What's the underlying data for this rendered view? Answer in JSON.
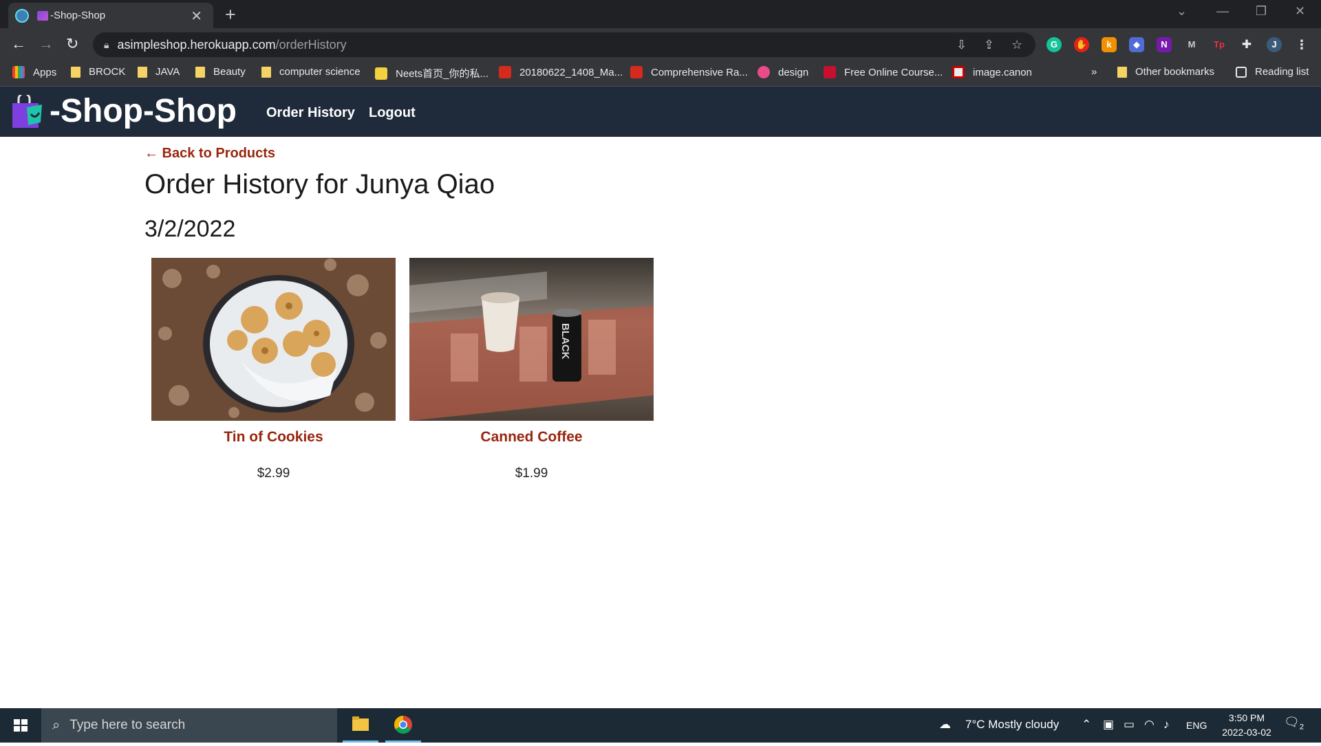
{
  "browser": {
    "tab_title": "-Shop-Shop",
    "url_host": "asimpleshop.herokuapp.com",
    "url_path": "/orderHistory",
    "bookmarks": [
      "Apps",
      "BROCK",
      "JAVA",
      "Beauty",
      "computer science",
      "Neets首页_你的私...",
      "20180622_1408_Ma...",
      "Comprehensive Ra...",
      "design",
      "Free Online Course...",
      "image.canon"
    ],
    "overflow": "»",
    "other_bookmarks": "Other bookmarks",
    "reading_list": "Reading list",
    "profile_initial": "J"
  },
  "site": {
    "title": "-Shop-Shop",
    "nav": [
      "Order History",
      "Logout"
    ]
  },
  "page": {
    "back_link": "← Back to Products",
    "title": "Order History for Junya Qiao",
    "order_date": "3/2/2022",
    "products": [
      {
        "name": "Tin of Cookies",
        "price": "$2.99",
        "image": "cookie-tin-photo"
      },
      {
        "name": "Canned Coffee",
        "price": "$1.99",
        "image": "coffee-can-photo"
      }
    ]
  },
  "taskbar": {
    "search_placeholder": "Type here to search",
    "weather": "7°C  Mostly cloudy",
    "language": "ENG",
    "time": "3:50 PM",
    "date": "2022-03-02",
    "notifications": "2"
  },
  "colors": {
    "header_bg": "#1f2a3a",
    "accent_link": "#98260d",
    "chrome_dark": "#202124",
    "taskbar_bg": "#1c2a35"
  }
}
